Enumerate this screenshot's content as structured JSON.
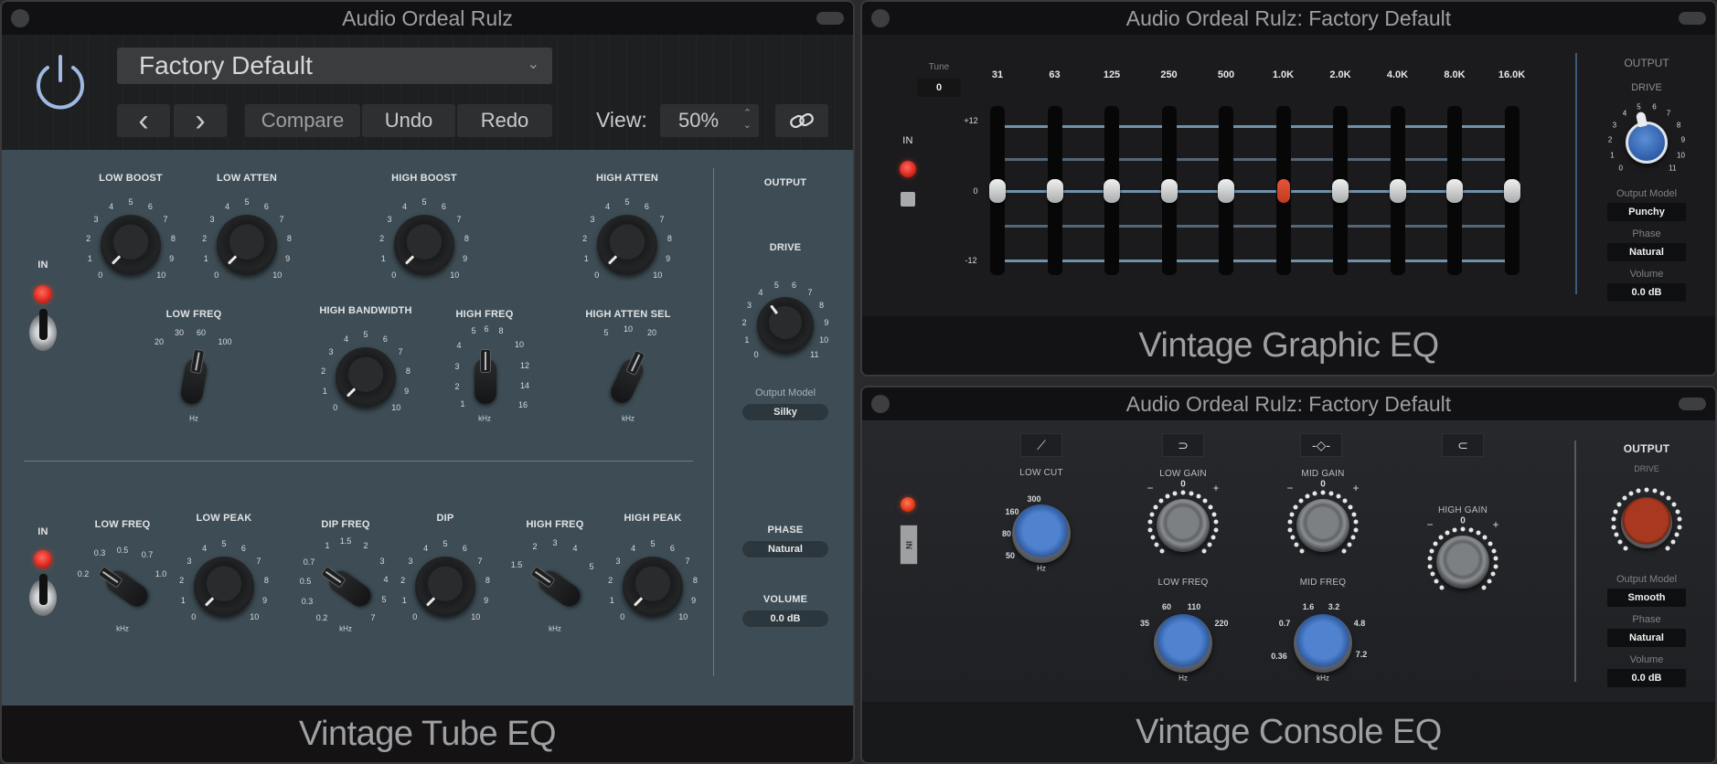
{
  "tube_eq": {
    "window_title": "Audio Ordeal Rulz",
    "preset": "Factory Default",
    "toolbar": {
      "prev_label": "‹",
      "next_label": "›",
      "compare_label": "Compare",
      "undo_label": "Undo",
      "redo_label": "Redo",
      "view_label": "View:",
      "view_value": "50%",
      "link_icon": "link-icon"
    },
    "footer_title": "Vintage Tube EQ",
    "top_section": {
      "in_label": "IN",
      "low_boost": {
        "label": "LOW BOOST",
        "ticks": [
          "0",
          "1",
          "2",
          "3",
          "4",
          "5",
          "6",
          "7",
          "8",
          "9",
          "10"
        ],
        "value": 0
      },
      "low_atten": {
        "label": "LOW ATTEN",
        "ticks": [
          "0",
          "1",
          "2",
          "3",
          "4",
          "5",
          "6",
          "7",
          "8",
          "9",
          "10"
        ],
        "value": 0
      },
      "high_boost": {
        "label": "HIGH BOOST",
        "ticks": [
          "0",
          "1",
          "2",
          "3",
          "4",
          "5",
          "6",
          "7",
          "8",
          "9",
          "10"
        ],
        "value": 0
      },
      "high_atten": {
        "label": "HIGH ATTEN",
        "ticks": [
          "0",
          "1",
          "2",
          "3",
          "4",
          "5",
          "6",
          "7",
          "8",
          "9",
          "10"
        ],
        "value": 0
      },
      "low_freq": {
        "label": "LOW FREQ",
        "ticks": [
          "20",
          "30",
          "60",
          "100"
        ],
        "unit": "Hz",
        "value": "60"
      },
      "high_bandwidth": {
        "label": "HIGH BANDWIDTH",
        "ticks": [
          "0",
          "1",
          "2",
          "3",
          "4",
          "5",
          "6",
          "7",
          "8",
          "9",
          "10"
        ],
        "value": 0
      },
      "high_freq": {
        "label": "HIGH FREQ",
        "ticks": [
          "1",
          "2",
          "3",
          "4",
          "5",
          "6",
          "8",
          "10",
          "12",
          "14",
          "16"
        ],
        "unit": "kHz",
        "value": "6"
      },
      "high_atten_sel": {
        "label": "HIGH ATTEN SEL",
        "ticks": [
          "5",
          "10",
          "20"
        ],
        "unit": "kHz",
        "value": "20"
      }
    },
    "bottom_section": {
      "in_label": "IN",
      "low_freq": {
        "label": "LOW FREQ",
        "ticks": [
          "0.2",
          "0.3",
          "0.5",
          "0.7",
          "1.0"
        ],
        "unit": "kHz",
        "value": "0.2"
      },
      "low_peak": {
        "label": "LOW PEAK",
        "ticks": [
          "0",
          "1",
          "2",
          "3",
          "4",
          "5",
          "6",
          "7",
          "8",
          "9",
          "10"
        ],
        "value": 0
      },
      "dip_freq": {
        "label": "DIP FREQ",
        "ticks": [
          "0.2",
          "0.3",
          "0.5",
          "0.7",
          "1",
          "1.5",
          "2",
          "3",
          "4",
          "5",
          "7"
        ],
        "unit": "kHz",
        "value": "0.7"
      },
      "dip": {
        "label": "DIP",
        "ticks": [
          "0",
          "1",
          "2",
          "3",
          "4",
          "5",
          "6",
          "7",
          "8",
          "9",
          "10"
        ],
        "value": 0
      },
      "high_freq": {
        "label": "HIGH FREQ",
        "ticks": [
          "1.5",
          "2",
          "3",
          "4",
          "5"
        ],
        "unit": "kHz",
        "value": "1.5"
      },
      "high_peak": {
        "label": "HIGH PEAK",
        "ticks": [
          "0",
          "1",
          "2",
          "3",
          "4",
          "5",
          "6",
          "7",
          "8",
          "9",
          "10"
        ],
        "value": 0
      }
    },
    "output": {
      "label": "OUTPUT",
      "drive": {
        "label": "DRIVE",
        "ticks": [
          "0",
          "1",
          "2",
          "3",
          "4",
          "5",
          "6",
          "7",
          "8",
          "9",
          "10",
          "11"
        ],
        "value": 4
      },
      "output_model_label": "Output Model",
      "output_model": "Silky",
      "phase_label": "PHASE",
      "phase": "Natural",
      "volume_label": "VOLUME",
      "volume": "0.0 dB"
    }
  },
  "graphic_eq": {
    "window_title": "Audio Ordeal Rulz: Factory Default",
    "footer_title": "Vintage Graphic EQ",
    "tune_label": "Tune",
    "tune_value": "0",
    "in_label": "IN",
    "scale": {
      "top": "+12",
      "mid": "0",
      "bottom": "-12"
    },
    "bands": [
      {
        "freq": "31",
        "gain_db": 0
      },
      {
        "freq": "63",
        "gain_db": 0
      },
      {
        "freq": "125",
        "gain_db": 0
      },
      {
        "freq": "250",
        "gain_db": 0
      },
      {
        "freq": "500",
        "gain_db": 0
      },
      {
        "freq": "1.0K",
        "gain_db": 0,
        "selected": true
      },
      {
        "freq": "2.0K",
        "gain_db": 0
      },
      {
        "freq": "4.0K",
        "gain_db": 0
      },
      {
        "freq": "8.0K",
        "gain_db": 0
      },
      {
        "freq": "16.0K",
        "gain_db": 0
      }
    ],
    "output": {
      "label": "OUTPUT",
      "drive": {
        "label": "DRIVE",
        "ticks": [
          "0",
          "1",
          "2",
          "3",
          "4",
          "5",
          "6",
          "7",
          "8",
          "9",
          "10",
          "11"
        ],
        "value": 5
      },
      "output_model_label": "Output Model",
      "output_model": "Punchy",
      "phase_label": "Phase",
      "phase": "Natural",
      "volume_label": "Volume",
      "volume": "0.0 dB"
    },
    "colors": {
      "accent": "#4a7fc8",
      "selected_band": "#c23a22"
    }
  },
  "console_eq": {
    "window_title": "Audio Ordeal Rulz: Factory Default",
    "footer_title": "Vintage Console EQ",
    "in_switch_label": "IN",
    "band_buttons": [
      {
        "name": "low-cut-filter-icon",
        "glyph": "⟋"
      },
      {
        "name": "low-shelf-icon",
        "glyph": "⊃"
      },
      {
        "name": "mid-bell-icon",
        "glyph": "-◇-"
      },
      {
        "name": "high-shelf-icon",
        "glyph": "⊂"
      }
    ],
    "low_cut": {
      "label": "LOW CUT",
      "ticks": [
        "50",
        "80",
        "160",
        "300"
      ],
      "unit": "Hz",
      "value": "50"
    },
    "low_gain": {
      "label": "LOW GAIN",
      "minus": "−",
      "zero": "0",
      "plus": "+",
      "value": 0
    },
    "low_freq": {
      "label": "LOW FREQ",
      "ticks": [
        "35",
        "60",
        "110",
        "220"
      ],
      "unit": "Hz",
      "value": "110"
    },
    "mid_gain": {
      "label": "MID GAIN",
      "minus": "−",
      "zero": "0",
      "plus": "+",
      "value": 0
    },
    "mid_freq": {
      "label": "MID FREQ",
      "ticks": [
        "0.36",
        "0.7",
        "1.6",
        "3.2",
        "4.8",
        "7.2"
      ],
      "unit": "kHz",
      "value": "3.2"
    },
    "high_gain": {
      "label": "HIGH GAIN",
      "minus": "−",
      "zero": "0",
      "plus": "+",
      "value": 0
    },
    "output": {
      "label": "OUTPUT",
      "drive_label": "DRIVE",
      "output_model_label": "Output Model",
      "output_model": "Smooth",
      "phase_label": "Phase",
      "phase": "Natural",
      "volume_label": "Volume",
      "volume": "0.0 dB"
    }
  }
}
